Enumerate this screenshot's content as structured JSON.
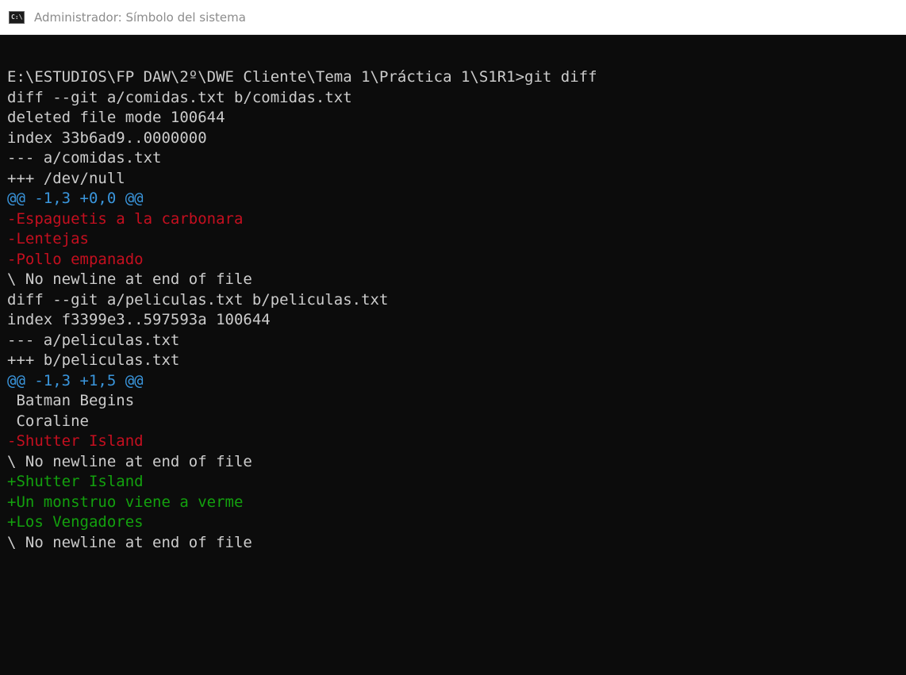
{
  "window": {
    "title": "Administrador: Símbolo del sistema",
    "icon": "cmd-icon",
    "icon_text": "C:\\."
  },
  "colors": {
    "background": "#0c0c0c",
    "default_text": "#cccccc",
    "hunk_header": "#3a96dd",
    "deleted": "#c50f1f",
    "added": "#13a10e"
  },
  "console": {
    "lines": [
      {
        "text": "E:\\ESTUDIOS\\FP DAW\\2º\\DWE Cliente\\Tema 1\\Práctica 1\\S1R1>git diff",
        "kind": "normal"
      },
      {
        "text": "diff --git a/comidas.txt b/comidas.txt",
        "kind": "normal"
      },
      {
        "text": "deleted file mode 100644",
        "kind": "normal"
      },
      {
        "text": "index 33b6ad9..0000000",
        "kind": "normal"
      },
      {
        "text": "--- a/comidas.txt",
        "kind": "normal"
      },
      {
        "text": "+++ /dev/null",
        "kind": "normal"
      },
      {
        "text": "@@ -1,3 +0,0 @@",
        "kind": "meta"
      },
      {
        "text": "-Espaguetis a la carbonara",
        "kind": "del"
      },
      {
        "text": "-Lentejas",
        "kind": "del"
      },
      {
        "text": "-Pollo empanado",
        "kind": "del"
      },
      {
        "text": "\\ No newline at end of file",
        "kind": "normal"
      },
      {
        "text": "diff --git a/peliculas.txt b/peliculas.txt",
        "kind": "normal"
      },
      {
        "text": "index f3399e3..597593a 100644",
        "kind": "normal"
      },
      {
        "text": "--- a/peliculas.txt",
        "kind": "normal"
      },
      {
        "text": "+++ b/peliculas.txt",
        "kind": "normal"
      },
      {
        "text": "@@ -1,3 +1,5 @@",
        "kind": "meta"
      },
      {
        "text": " Batman Begins",
        "kind": "normal"
      },
      {
        "text": " Coraline",
        "kind": "normal"
      },
      {
        "text": "-Shutter Island",
        "kind": "del"
      },
      {
        "text": "\\ No newline at end of file",
        "kind": "normal"
      },
      {
        "text": "+Shutter Island",
        "kind": "add"
      },
      {
        "text": "+Un monstruo viene a verme",
        "kind": "add"
      },
      {
        "text": "+Los Vengadores",
        "kind": "add"
      },
      {
        "text": "\\ No newline at end of file",
        "kind": "normal"
      }
    ]
  }
}
